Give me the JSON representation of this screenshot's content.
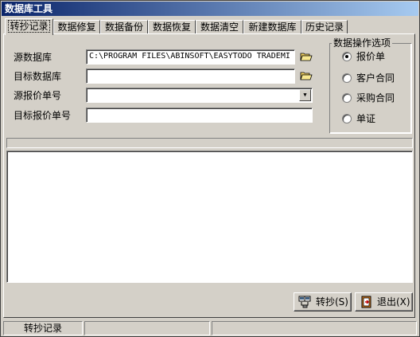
{
  "window": {
    "title": "数据库工具"
  },
  "tabs": [
    {
      "label": "转抄记录"
    },
    {
      "label": "数据修复"
    },
    {
      "label": "数据备份"
    },
    {
      "label": "数据恢复"
    },
    {
      "label": "数据清空"
    },
    {
      "label": "新建数据库"
    },
    {
      "label": "历史记录"
    }
  ],
  "form": {
    "source_db_label": "源数据库",
    "source_db_value": "C:\\PROGRAM FILES\\ABINSOFT\\EASYTODO TRADEMI",
    "target_db_label": "目标数据库",
    "target_db_value": "",
    "source_quote_label": "源报价单号",
    "source_quote_value": "",
    "target_quote_label": "目标报价单号",
    "target_quote_value": ""
  },
  "options": {
    "title": "数据操作选项",
    "items": [
      {
        "label": "报价单",
        "selected": true
      },
      {
        "label": "客户合同",
        "selected": false
      },
      {
        "label": "采购合同",
        "selected": false
      },
      {
        "label": "单证",
        "selected": false
      }
    ]
  },
  "buttons": {
    "copy": "转抄(S)",
    "exit": "退出(X)"
  },
  "statusbar": {
    "cell1": "转抄记录",
    "cell2": "",
    "cell3": ""
  },
  "icons": {
    "browse": "folder-open-icon",
    "dropdown": "chevron-down-icon",
    "copy": "copy-records-icon",
    "exit": "exit-door-icon"
  },
  "colors": {
    "face": "#d4d0c8",
    "title_start": "#0a246a",
    "title_end": "#a6caf0"
  }
}
